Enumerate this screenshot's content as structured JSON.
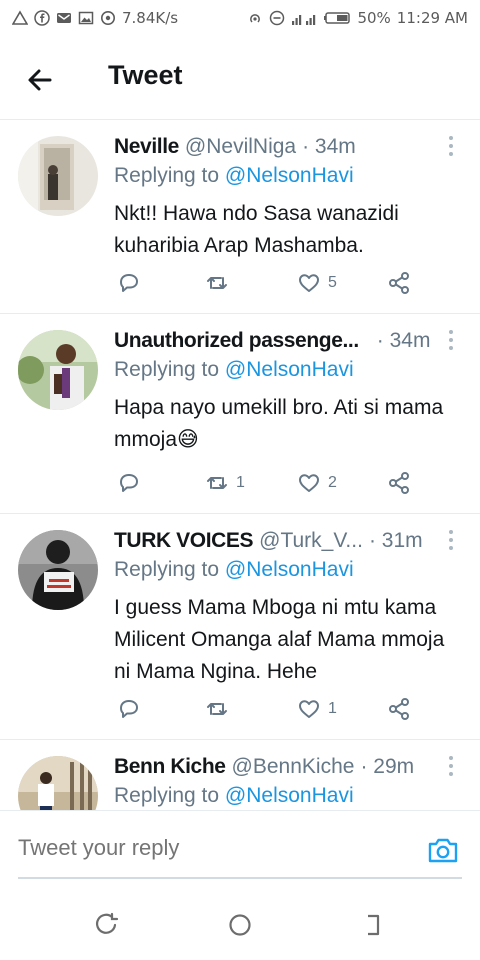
{
  "status_bar": {
    "speed": "7.84K/s",
    "battery": "50%",
    "time": "11:29 AM"
  },
  "app_bar": {
    "title": "Tweet"
  },
  "tweets": [
    {
      "name": "Neville",
      "handle": "@NevilNiga",
      "time": "· 34m",
      "replying_prefix": "Replying to ",
      "replying_to": "@NelsonHavi",
      "text": "Nkt!! Hawa ndo Sasa wanazidi kuharibia Arap Mashamba.",
      "retweets": "",
      "likes": "5"
    },
    {
      "name": "Unauthorized passenge...",
      "handle": "",
      "time": "· 34m",
      "replying_prefix": "Replying to ",
      "replying_to": "@NelsonHavi",
      "text": "Hapa nayo umekill bro. Ati si mama mmoja😅",
      "retweets": "1",
      "likes": "2"
    },
    {
      "name": "TURK VOICES",
      "handle": "@Turk_V...",
      "time": "· 31m",
      "replying_prefix": "Replying to ",
      "replying_to": "@NelsonHavi",
      "text": "I guess Mama Mboga ni mtu kama Milicent Omanga alaf Mama mmoja ni Mama Ngina. Hehe",
      "retweets": "",
      "likes": "1"
    },
    {
      "name": "Benn Kiche",
      "handle": "@BennKiche",
      "time": "· 29m",
      "replying_prefix": "Replying to ",
      "replying_to": "@NelsonHavi",
      "text": "",
      "retweets": "",
      "likes": ""
    }
  ],
  "composer": {
    "placeholder": "Tweet your reply"
  },
  "icons": {
    "back": "arrow-left-icon",
    "reply": "reply-icon",
    "retweet": "retweet-icon",
    "like": "heart-icon",
    "share": "share-icon",
    "camera": "camera-icon",
    "more": "more-vertical-icon"
  },
  "colors": {
    "accent": "#1da1f2",
    "mention": "#1b95e0",
    "secondary_text": "#657786"
  }
}
